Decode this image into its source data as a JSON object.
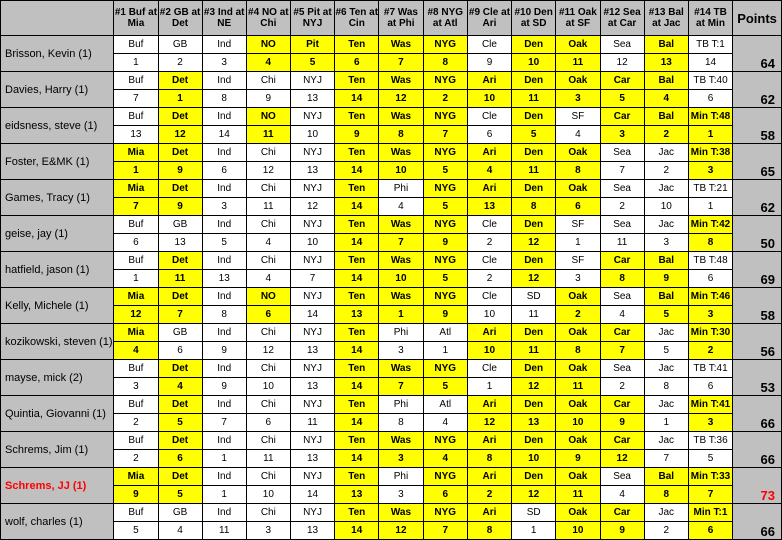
{
  "headers": [
    "#1 Buf at Mia",
    "#2 GB at Det",
    "#3 Ind at NE",
    "#4 NO at Chi",
    "#5 Pit at NYJ",
    "#6 Ten at Cin",
    "#7 Was at Phi",
    "#8 NYG at Atl",
    "#9 Cle at Ari",
    "#10 Den at SD",
    "#11 Oak at SF",
    "#12 Sea at Car",
    "#13 Bal at Jac",
    "#14 TB at Min"
  ],
  "points_header": "Points",
  "players": [
    {
      "name": "Brisson, Kevin (1)",
      "red": false,
      "points": "64",
      "picks": [
        "Buf",
        "GB",
        "Ind",
        "NO",
        "Pit",
        "Ten",
        "Was",
        "NYG",
        "Cle",
        "Den",
        "Oak",
        "Sea",
        "Bal",
        "TB T:1"
      ],
      "nums": [
        "1",
        "2",
        "3",
        "4",
        "5",
        "6",
        "7",
        "8",
        "9",
        "10",
        "11",
        "12",
        "13",
        "14"
      ],
      "hl_p": [
        0,
        0,
        0,
        1,
        1,
        1,
        1,
        1,
        0,
        1,
        1,
        0,
        1,
        0
      ],
      "hl_n": [
        0,
        0,
        0,
        1,
        1,
        1,
        1,
        1,
        0,
        1,
        1,
        0,
        1,
        0
      ]
    },
    {
      "name": "Davies, Harry (1)",
      "red": false,
      "points": "62",
      "picks": [
        "Buf",
        "Det",
        "Ind",
        "Chi",
        "NYJ",
        "Ten",
        "Was",
        "NYG",
        "Ari",
        "Den",
        "Oak",
        "Car",
        "Bal",
        "TB T:40"
      ],
      "nums": [
        "7",
        "1",
        "8",
        "9",
        "13",
        "14",
        "12",
        "2",
        "10",
        "11",
        "3",
        "5",
        "4",
        "6"
      ],
      "hl_p": [
        0,
        1,
        0,
        0,
        0,
        1,
        1,
        1,
        1,
        1,
        1,
        1,
        1,
        0
      ],
      "hl_n": [
        0,
        1,
        0,
        0,
        0,
        1,
        1,
        1,
        1,
        1,
        1,
        1,
        1,
        0
      ]
    },
    {
      "name": "eidsness, steve (1)",
      "red": false,
      "points": "58",
      "picks": [
        "Buf",
        "Det",
        "Ind",
        "NO",
        "NYJ",
        "Ten",
        "Was",
        "NYG",
        "Cle",
        "Den",
        "SF",
        "Car",
        "Bal",
        "Min T:48"
      ],
      "nums": [
        "13",
        "12",
        "14",
        "11",
        "10",
        "9",
        "8",
        "7",
        "6",
        "5",
        "4",
        "3",
        "2",
        "1"
      ],
      "hl_p": [
        0,
        1,
        0,
        1,
        0,
        1,
        1,
        1,
        0,
        1,
        0,
        1,
        1,
        1
      ],
      "hl_n": [
        0,
        1,
        0,
        1,
        0,
        1,
        1,
        1,
        0,
        1,
        0,
        1,
        1,
        1
      ]
    },
    {
      "name": "Foster, E&MK (1)",
      "red": false,
      "points": "65",
      "picks": [
        "Mia",
        "Det",
        "Ind",
        "Chi",
        "NYJ",
        "Ten",
        "Was",
        "NYG",
        "Ari",
        "Den",
        "Oak",
        "Sea",
        "Jac",
        "Min T:38"
      ],
      "nums": [
        "1",
        "9",
        "6",
        "12",
        "13",
        "14",
        "10",
        "5",
        "4",
        "11",
        "8",
        "7",
        "2",
        "3"
      ],
      "hl_p": [
        1,
        1,
        0,
        0,
        0,
        1,
        1,
        1,
        1,
        1,
        1,
        0,
        0,
        1
      ],
      "hl_n": [
        1,
        1,
        0,
        0,
        0,
        1,
        1,
        1,
        1,
        1,
        1,
        0,
        0,
        1
      ]
    },
    {
      "name": "Games, Tracy (1)",
      "red": false,
      "points": "62",
      "picks": [
        "Mia",
        "Det",
        "Ind",
        "Chi",
        "NYJ",
        "Ten",
        "Phi",
        "NYG",
        "Ari",
        "Den",
        "Oak",
        "Sea",
        "Jac",
        "TB T:21"
      ],
      "nums": [
        "7",
        "9",
        "3",
        "11",
        "12",
        "14",
        "4",
        "5",
        "13",
        "8",
        "6",
        "2",
        "10",
        "1"
      ],
      "hl_p": [
        1,
        1,
        0,
        0,
        0,
        1,
        0,
        1,
        1,
        1,
        1,
        0,
        0,
        0
      ],
      "hl_n": [
        1,
        1,
        0,
        0,
        0,
        1,
        0,
        1,
        1,
        1,
        1,
        0,
        0,
        0
      ]
    },
    {
      "name": "geise, jay (1)",
      "red": false,
      "points": "50",
      "picks": [
        "Buf",
        "GB",
        "Ind",
        "Chi",
        "NYJ",
        "Ten",
        "Was",
        "NYG",
        "Cle",
        "Den",
        "SF",
        "Sea",
        "Jac",
        "Min T:42"
      ],
      "nums": [
        "6",
        "13",
        "5",
        "4",
        "10",
        "14",
        "7",
        "9",
        "2",
        "12",
        "1",
        "11",
        "3",
        "8"
      ],
      "hl_p": [
        0,
        0,
        0,
        0,
        0,
        1,
        1,
        1,
        0,
        1,
        0,
        0,
        0,
        1
      ],
      "hl_n": [
        0,
        0,
        0,
        0,
        0,
        1,
        1,
        1,
        0,
        1,
        0,
        0,
        0,
        1
      ]
    },
    {
      "name": "hatfield, jason (1)",
      "red": false,
      "points": "69",
      "picks": [
        "Buf",
        "Det",
        "Ind",
        "Chi",
        "NYJ",
        "Ten",
        "Was",
        "NYG",
        "Cle",
        "Den",
        "SF",
        "Car",
        "Bal",
        "TB T:48"
      ],
      "nums": [
        "1",
        "11",
        "13",
        "4",
        "7",
        "14",
        "10",
        "5",
        "2",
        "12",
        "3",
        "8",
        "9",
        "6"
      ],
      "hl_p": [
        0,
        1,
        0,
        0,
        0,
        1,
        1,
        1,
        0,
        1,
        0,
        1,
        1,
        0
      ],
      "hl_n": [
        0,
        1,
        0,
        0,
        0,
        1,
        1,
        1,
        0,
        1,
        0,
        1,
        1,
        0
      ]
    },
    {
      "name": "Kelly, Michele (1)",
      "red": false,
      "points": "58",
      "picks": [
        "Mia",
        "Det",
        "Ind",
        "NO",
        "NYJ",
        "Ten",
        "Was",
        "NYG",
        "Cle",
        "SD",
        "Oak",
        "Sea",
        "Bal",
        "Min T:46"
      ],
      "nums": [
        "12",
        "7",
        "8",
        "6",
        "14",
        "13",
        "1",
        "9",
        "10",
        "11",
        "2",
        "4",
        "5",
        "3"
      ],
      "hl_p": [
        1,
        1,
        0,
        1,
        0,
        1,
        1,
        1,
        0,
        0,
        1,
        0,
        1,
        1
      ],
      "hl_n": [
        1,
        1,
        0,
        1,
        0,
        1,
        1,
        1,
        0,
        0,
        1,
        0,
        1,
        1
      ]
    },
    {
      "name": "kozikowski, steven (1)",
      "red": false,
      "points": "56",
      "picks": [
        "Mia",
        "GB",
        "Ind",
        "Chi",
        "NYJ",
        "Ten",
        "Phi",
        "Atl",
        "Ari",
        "Den",
        "Oak",
        "Car",
        "Jac",
        "Min T:30"
      ],
      "nums": [
        "4",
        "6",
        "9",
        "12",
        "13",
        "14",
        "3",
        "1",
        "10",
        "11",
        "8",
        "7",
        "5",
        "2"
      ],
      "hl_p": [
        1,
        0,
        0,
        0,
        0,
        1,
        0,
        0,
        1,
        1,
        1,
        1,
        0,
        1
      ],
      "hl_n": [
        1,
        0,
        0,
        0,
        0,
        1,
        0,
        0,
        1,
        1,
        1,
        1,
        0,
        1
      ]
    },
    {
      "name": "mayse, mick (2)",
      "red": false,
      "points": "53",
      "picks": [
        "Buf",
        "Det",
        "Ind",
        "Chi",
        "NYJ",
        "Ten",
        "Was",
        "NYG",
        "Cle",
        "Den",
        "Oak",
        "Sea",
        "Jac",
        "TB T:41"
      ],
      "nums": [
        "3",
        "4",
        "9",
        "10",
        "13",
        "14",
        "7",
        "5",
        "1",
        "12",
        "11",
        "2",
        "8",
        "6"
      ],
      "hl_p": [
        0,
        1,
        0,
        0,
        0,
        1,
        1,
        1,
        0,
        1,
        1,
        0,
        0,
        0
      ],
      "hl_n": [
        0,
        1,
        0,
        0,
        0,
        1,
        1,
        1,
        0,
        1,
        1,
        0,
        0,
        0
      ]
    },
    {
      "name": "Quintia, Giovanni (1)",
      "red": false,
      "points": "66",
      "picks": [
        "Buf",
        "Det",
        "Ind",
        "Chi",
        "NYJ",
        "Ten",
        "Phi",
        "Atl",
        "Ari",
        "Den",
        "Oak",
        "Car",
        "Jac",
        "Min T:41"
      ],
      "nums": [
        "2",
        "5",
        "7",
        "6",
        "11",
        "14",
        "8",
        "4",
        "12",
        "13",
        "10",
        "9",
        "1",
        "3"
      ],
      "hl_p": [
        0,
        1,
        0,
        0,
        0,
        1,
        0,
        0,
        1,
        1,
        1,
        1,
        0,
        1
      ],
      "hl_n": [
        0,
        1,
        0,
        0,
        0,
        1,
        0,
        0,
        1,
        1,
        1,
        1,
        0,
        1
      ]
    },
    {
      "name": "Schrems, Jim (1)",
      "red": false,
      "points": "66",
      "picks": [
        "Buf",
        "Det",
        "Ind",
        "Chi",
        "NYJ",
        "Ten",
        "Was",
        "NYG",
        "Ari",
        "Den",
        "Oak",
        "Car",
        "Jac",
        "TB T:36"
      ],
      "nums": [
        "2",
        "6",
        "1",
        "11",
        "13",
        "14",
        "3",
        "4",
        "8",
        "10",
        "9",
        "12",
        "7",
        "5"
      ],
      "hl_p": [
        0,
        1,
        0,
        0,
        0,
        1,
        1,
        1,
        1,
        1,
        1,
        1,
        0,
        0
      ],
      "hl_n": [
        0,
        1,
        0,
        0,
        0,
        1,
        1,
        1,
        1,
        1,
        1,
        1,
        0,
        0
      ]
    },
    {
      "name": "Schrems, JJ (1)",
      "red": true,
      "points": "73",
      "picks": [
        "Mia",
        "Det",
        "Ind",
        "Chi",
        "NYJ",
        "Ten",
        "Phi",
        "NYG",
        "Ari",
        "Den",
        "Oak",
        "Sea",
        "Bal",
        "Min T:33"
      ],
      "nums": [
        "9",
        "5",
        "1",
        "10",
        "14",
        "13",
        "3",
        "6",
        "2",
        "12",
        "11",
        "4",
        "8",
        "7"
      ],
      "hl_p": [
        1,
        1,
        0,
        0,
        0,
        1,
        0,
        1,
        1,
        1,
        1,
        0,
        1,
        1
      ],
      "hl_n": [
        1,
        1,
        0,
        0,
        0,
        1,
        0,
        1,
        1,
        1,
        1,
        0,
        1,
        1
      ]
    },
    {
      "name": "wolf, charles (1)",
      "red": false,
      "points": "66",
      "picks": [
        "Buf",
        "GB",
        "Ind",
        "Chi",
        "NYJ",
        "Ten",
        "Was",
        "NYG",
        "Ari",
        "SD",
        "Oak",
        "Car",
        "Jac",
        "Min T:1"
      ],
      "nums": [
        "5",
        "4",
        "11",
        "3",
        "13",
        "14",
        "12",
        "7",
        "8",
        "1",
        "10",
        "9",
        "2",
        "6"
      ],
      "hl_p": [
        0,
        0,
        0,
        0,
        0,
        1,
        1,
        1,
        1,
        0,
        1,
        1,
        0,
        1
      ],
      "hl_n": [
        0,
        0,
        0,
        0,
        0,
        1,
        1,
        1,
        1,
        0,
        1,
        1,
        0,
        1
      ]
    }
  ]
}
